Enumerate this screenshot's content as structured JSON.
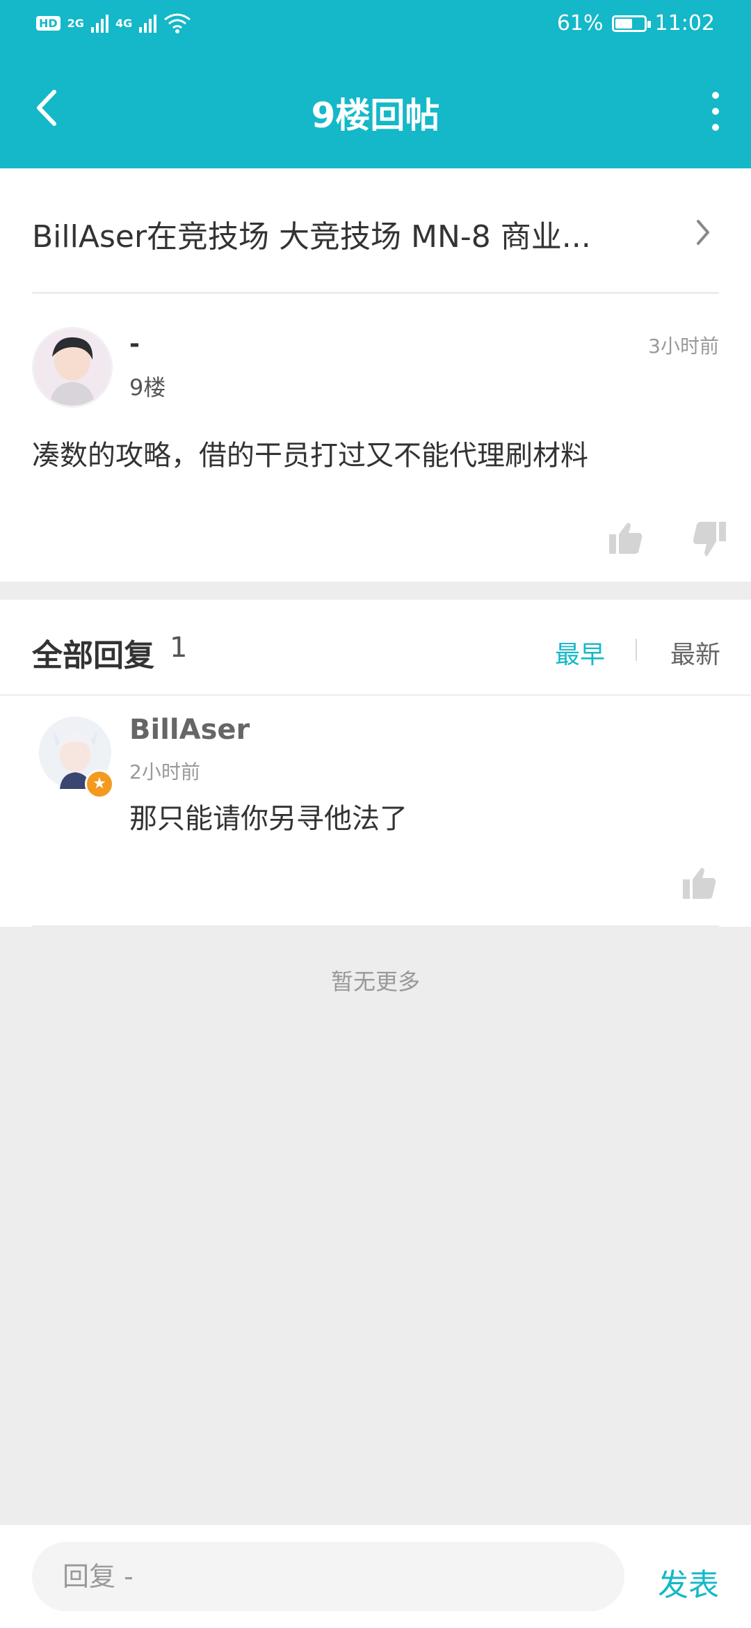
{
  "status_bar": {
    "hd": "HD",
    "net1": "2G",
    "net2": "4G",
    "battery_percent_text": "61%",
    "battery_level": 0.61,
    "time": "11:02"
  },
  "app_bar": {
    "title": "9楼回帖",
    "back_icon": "chevron-left-icon",
    "more_icon": "more-vertical-icon"
  },
  "post": {
    "topic": "BillAser在竞技场 大竞技场 MN-8 商业...",
    "author": "-",
    "floor": "9楼",
    "time": "3小时前",
    "content": "凑数的攻略，借的干员打过又不能代理刷材料"
  },
  "replies": {
    "title": "全部回复",
    "count": "1",
    "sort_earliest": "最早",
    "sort_newest": "最新",
    "items": [
      {
        "author": "BillAser",
        "time": "2小时前",
        "content": "那只能请你另寻他法了"
      }
    ],
    "no_more": "暂无更多"
  },
  "reply_bar": {
    "placeholder": "回复 -",
    "send_label": "发表"
  },
  "colors": {
    "accent": "#14b8c8",
    "badge": "#f39a1e",
    "background": "#ededed"
  }
}
